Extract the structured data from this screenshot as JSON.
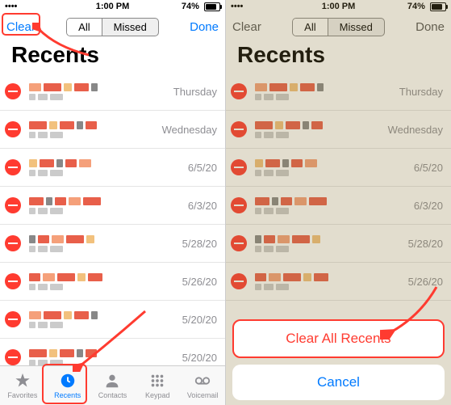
{
  "status": {
    "time": "1:00 PM",
    "battery": "74%"
  },
  "nav": {
    "clear": "Clear",
    "done": "Done",
    "segAll": "All",
    "segMissed": "Missed"
  },
  "title": "Recents",
  "rows": [
    {
      "date": "Thursday"
    },
    {
      "date": "Wednesday"
    },
    {
      "date": "6/5/20"
    },
    {
      "date": "6/3/20"
    },
    {
      "date": "5/28/20"
    },
    {
      "date": "5/26/20"
    },
    {
      "date": "5/20/20"
    },
    {
      "date": "5/20/20"
    }
  ],
  "tabs": {
    "favorites": "Favorites",
    "recents": "Recents",
    "contacts": "Contacts",
    "keypad": "Keypad",
    "voicemail": "Voicemail"
  },
  "actionSheet": {
    "clearAll": "Clear All Recents",
    "cancel": "Cancel"
  }
}
